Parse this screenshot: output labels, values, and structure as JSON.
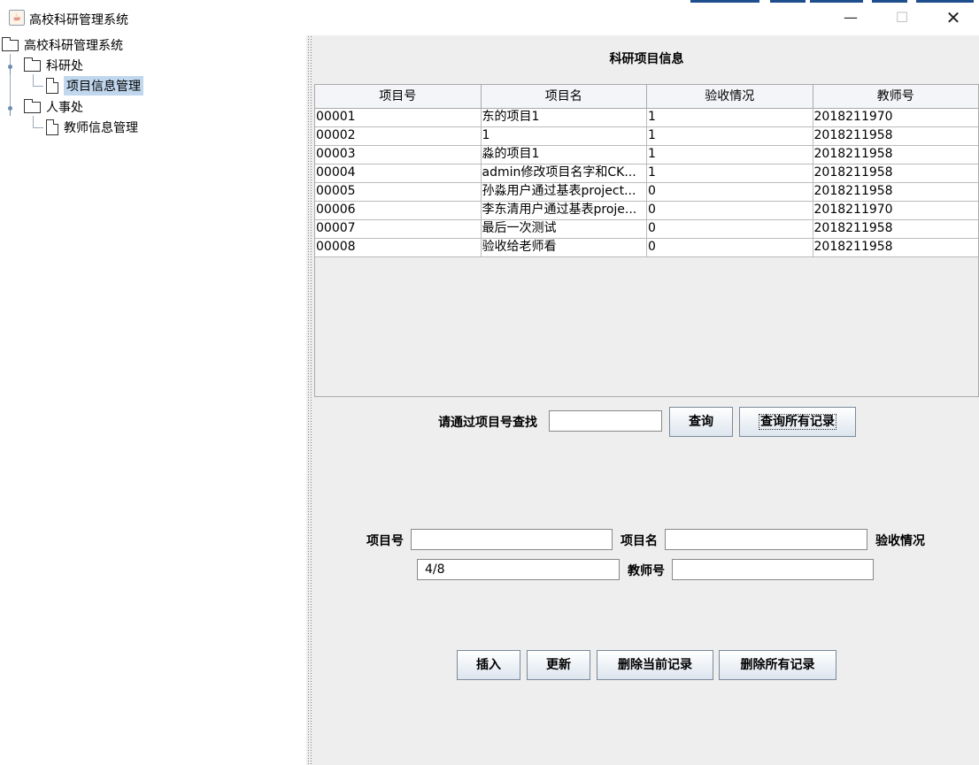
{
  "window": {
    "title": "高校科研管理系统"
  },
  "tree": {
    "root": "高校科研管理系统",
    "nodes": [
      {
        "label": "科研处",
        "children": [
          "项目信息管理"
        ]
      },
      {
        "label": "人事处",
        "children": [
          "教师信息管理"
        ]
      }
    ],
    "selected": "项目信息管理"
  },
  "panel": {
    "title": "科研项目信息"
  },
  "table": {
    "headers": [
      "项目号",
      "项目名",
      "验收情况",
      "教师号"
    ],
    "rows": [
      [
        "00001",
        "东的项目1",
        "1",
        "2018211970"
      ],
      [
        "00002",
        "1",
        "1",
        "2018211958"
      ],
      [
        "00003",
        "淼的项目1",
        "1",
        "2018211958"
      ],
      [
        "00004",
        "admin修改项目名字和CK...",
        "1",
        "2018211958"
      ],
      [
        "00005",
        "孙淼用户通过基表project...",
        "0",
        "2018211958"
      ],
      [
        "00006",
        "李东清用户通过基表proje...",
        "0",
        "2018211970"
      ],
      [
        "00007",
        "最后一次测试",
        "0",
        "2018211958"
      ],
      [
        "00008",
        "验收给老师看",
        "0",
        "2018211958"
      ]
    ]
  },
  "search": {
    "label": "请通过项目号查找",
    "value": "",
    "query_button": "查询",
    "query_all_button": "查询所有记录"
  },
  "form": {
    "id_label": "项目号",
    "id_value": "",
    "name_label": "项目名",
    "name_value": "",
    "status_label": "验收情况",
    "status_value": "4/8",
    "teacher_label": "教师号",
    "teacher_value": ""
  },
  "actions": {
    "insert": "插入",
    "update": "更新",
    "delete_current": "删除当前记录",
    "delete_all": "删除所有记录"
  }
}
